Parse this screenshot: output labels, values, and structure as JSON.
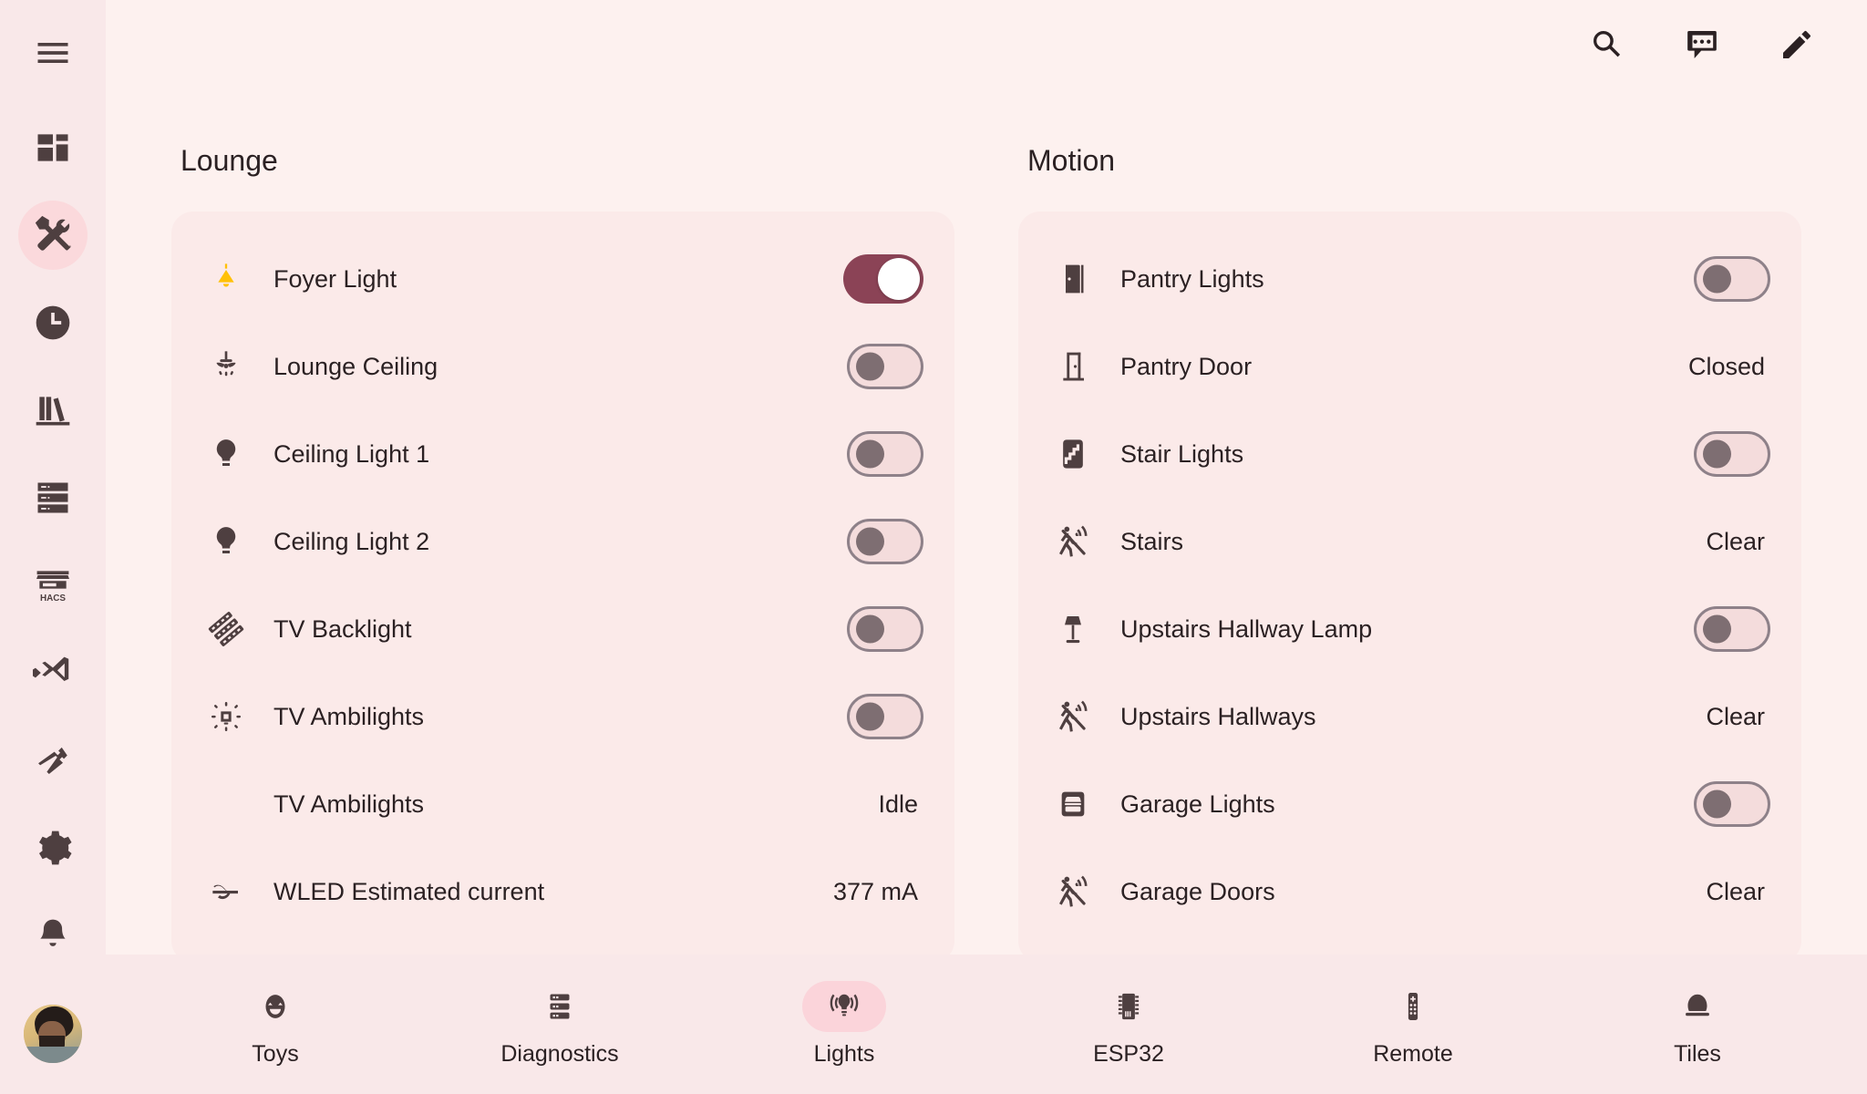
{
  "sidebar": {
    "items": [
      {
        "name": "menu",
        "icon": "hamburger-icon",
        "active": false
      },
      {
        "name": "overview",
        "icon": "dashboard-icon",
        "active": false
      },
      {
        "name": "developer-tools",
        "icon": "tools-icon",
        "active": true
      },
      {
        "name": "history",
        "icon": "clock-icon",
        "active": false
      },
      {
        "name": "media",
        "icon": "bookshelf-icon",
        "active": false
      },
      {
        "name": "logbook",
        "icon": "server-icon",
        "active": false
      },
      {
        "name": "hacs",
        "icon": "hacs-storefront-icon",
        "active": false
      },
      {
        "name": "vscode",
        "icon": "vscode-icon",
        "active": false
      },
      {
        "name": "terminal",
        "icon": "hammer-icon",
        "active": false
      },
      {
        "name": "settings",
        "icon": "gear-icon",
        "active": false
      },
      {
        "name": "notifications",
        "icon": "bell-icon",
        "active": false
      }
    ],
    "avatar_label": "User profile"
  },
  "toolbar": {
    "buttons": [
      {
        "name": "search",
        "icon": "search-icon"
      },
      {
        "name": "assist",
        "icon": "chat-bubble-icon"
      },
      {
        "name": "edit-dashboard",
        "icon": "pencil-icon"
      }
    ]
  },
  "columns": [
    {
      "title": "Lounge",
      "rows": [
        {
          "icon": "ceiling-pendant-lamp-icon",
          "icon_color": "amber",
          "name": "Foyer Light",
          "control": "toggle",
          "state": "on"
        },
        {
          "icon": "ceiling-fan-light-icon",
          "icon_color": "dark",
          "name": "Lounge Ceiling",
          "control": "toggle",
          "state": "off"
        },
        {
          "icon": "lightbulb-icon",
          "icon_color": "dark",
          "name": "Ceiling Light 1",
          "control": "toggle",
          "state": "off"
        },
        {
          "icon": "lightbulb-icon",
          "icon_color": "dark",
          "name": "Ceiling Light 2",
          "control": "toggle",
          "state": "off"
        },
        {
          "icon": "led-strip-icon",
          "icon_color": "dark",
          "name": "TV Backlight",
          "control": "toggle",
          "state": "off"
        },
        {
          "icon": "led-glow-icon",
          "icon_color": "dark",
          "name": "TV Ambilights",
          "control": "toggle",
          "state": "off"
        },
        {
          "icon": "none",
          "icon_color": "dark",
          "name": "TV Ambilights",
          "control": "text",
          "state": "Idle"
        },
        {
          "icon": "current-ac-icon",
          "icon_color": "dark",
          "name": "WLED Estimated current",
          "control": "text",
          "state": "377 mA"
        }
      ]
    },
    {
      "title": "Motion",
      "rows": [
        {
          "icon": "door-open-icon",
          "icon_color": "dark",
          "name": "Pantry Lights",
          "control": "toggle",
          "state": "off"
        },
        {
          "icon": "door-closed-icon",
          "icon_color": "dark",
          "name": "Pantry Door",
          "control": "text",
          "state": "Closed"
        },
        {
          "icon": "stairs-icon",
          "icon_color": "dark",
          "name": "Stair Lights",
          "control": "toggle",
          "state": "off"
        },
        {
          "icon": "motion-sensor-off-icon",
          "icon_color": "dark",
          "name": "Stairs",
          "control": "text",
          "state": "Clear"
        },
        {
          "icon": "floor-lamp-icon",
          "icon_color": "dark",
          "name": "Upstairs Hallway Lamp",
          "control": "toggle",
          "state": "off"
        },
        {
          "icon": "motion-sensor-off-icon",
          "icon_color": "dark",
          "name": "Upstairs Hallways",
          "control": "text",
          "state": "Clear"
        },
        {
          "icon": "garage-icon",
          "icon_color": "dark",
          "name": "Garage Lights",
          "control": "toggle",
          "state": "off"
        },
        {
          "icon": "motion-sensor-off-icon",
          "icon_color": "dark",
          "name": "Garage Doors",
          "control": "text",
          "state": "Clear"
        }
      ]
    }
  ],
  "bottom_nav": {
    "items": [
      {
        "label": "Toys",
        "icon": "emoticon-icon",
        "active": false
      },
      {
        "label": "Diagnostics",
        "icon": "server-rack-icon",
        "active": false
      },
      {
        "label": "Lights",
        "icon": "lamps-icon",
        "active": true
      },
      {
        "label": "ESP32",
        "icon": "chip-icon",
        "active": false
      },
      {
        "label": "Remote",
        "icon": "remote-control-icon",
        "active": false
      },
      {
        "label": "Tiles",
        "icon": "dome-icon",
        "active": false
      }
    ]
  },
  "colors": {
    "page_background": "#FDF1EF",
    "sidebar_background": "#F9E8E9",
    "card_background": "#FBEAE9",
    "accent_on": "#8B4356",
    "active_pill": "#FBD4DA",
    "text": "#2B2123",
    "icon": "#4E3F40",
    "amber": "#FFC107"
  }
}
